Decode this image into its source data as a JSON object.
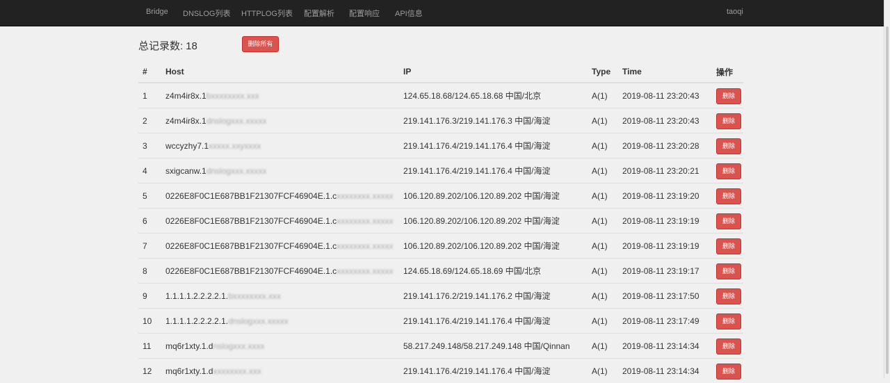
{
  "nav": {
    "items": [
      "Bridge",
      "DNSLOG列表",
      "HTTPLOG列表",
      "配置解析",
      "配置响应",
      "API信息"
    ],
    "user": "taoqi"
  },
  "summary": {
    "label": "总记录数:",
    "count": "18",
    "delete_all": "删除所有"
  },
  "table": {
    "headers": [
      "#",
      "Host",
      "IP",
      "Type",
      "Time",
      "操作"
    ],
    "rows": [
      {
        "num": "1",
        "host": "z4m4ir8x.1",
        "host_hidden": "bxxxxxxxx.xxx",
        "ip": "124.65.18.68/124.65.18.68 中国/北京",
        "type": "A(1)",
        "time": "2019-08-11 23:20:43",
        "action": "删除"
      },
      {
        "num": "2",
        "host": "z4m4ir8x.1",
        "host_hidden": "dnslogxxx.xxxxx",
        "ip": "219.141.176.3/219.141.176.3 中国/海淀",
        "type": "A(1)",
        "time": "2019-08-11 23:20:43",
        "action": "删除"
      },
      {
        "num": "3",
        "host": "wccyzhy7.1",
        "host_hidden": "xxxxx.xxyxxxx",
        "ip": "219.141.176.4/219.141.176.4 中国/海淀",
        "type": "A(1)",
        "time": "2019-08-11 23:20:28",
        "action": "删除"
      },
      {
        "num": "4",
        "host": "sxigcanw.1",
        "host_hidden": "dnslogxxx.xxxxx",
        "ip": "219.141.176.4/219.141.176.4 中国/海淀",
        "type": "A(1)",
        "time": "2019-08-11 23:20:21",
        "action": "删除"
      },
      {
        "num": "5",
        "host": "0226E8F0C1E687BB1F21307FCF46904E.1.c",
        "host_hidden": "xxxxxxxx.xxxxx",
        "ip": "106.120.89.202/106.120.89.202 中国/海淀",
        "type": "A(1)",
        "time": "2019-08-11 23:19:20",
        "action": "删除"
      },
      {
        "num": "6",
        "host": "0226E8F0C1E687BB1F21307FCF46904E.1.c",
        "host_hidden": "xxxxxxxx.xxxxx",
        "ip": "106.120.89.202/106.120.89.202 中国/海淀",
        "type": "A(1)",
        "time": "2019-08-11 23:19:19",
        "action": "删除"
      },
      {
        "num": "7",
        "host": "0226E8F0C1E687BB1F21307FCF46904E.1.c",
        "host_hidden": "xxxxxxxx.xxxxx",
        "ip": "106.120.89.202/106.120.89.202 中国/海淀",
        "type": "A(1)",
        "time": "2019-08-11 23:19:19",
        "action": "删除"
      },
      {
        "num": "8",
        "host": "0226E8F0C1E687BB1F21307FCF46904E.1.c",
        "host_hidden": "xxxxxxxx.xxxxx",
        "ip": "124.65.18.69/124.65.18.69 中国/北京",
        "type": "A(1)",
        "time": "2019-08-11 23:19:17",
        "action": "删除"
      },
      {
        "num": "9",
        "host": "1.1.1.1.2.2.2.2.1.",
        "host_hidden": "bxxxxxxxx.xxx",
        "ip": "219.141.176.2/219.141.176.2 中国/海淀",
        "type": "A(1)",
        "time": "2019-08-11 23:17:50",
        "action": "删除"
      },
      {
        "num": "10",
        "host": "1.1.1.1.2.2.2.2.1.",
        "host_hidden": "dnslogxxx.xxxxx",
        "ip": "219.141.176.4/219.141.176.4 中国/海淀",
        "type": "A(1)",
        "time": "2019-08-11 23:17:49",
        "action": "删除"
      },
      {
        "num": "11",
        "host": "mq6r1xty.1.d",
        "host_hidden": "nslogxxx.xxxx",
        "ip": "58.217.249.148/58.217.249.148 中国/Qinnan",
        "type": "A(1)",
        "time": "2019-08-11 23:14:34",
        "action": "删除"
      },
      {
        "num": "12",
        "host": "mq6r1xty.1.d",
        "host_hidden": "xxxxxxxx.xxx",
        "ip": "219.141.176.4/219.141.176.4 中国/海淀",
        "type": "A(1)",
        "time": "2019-08-11 23:14:34",
        "action": "删除"
      }
    ]
  },
  "colors": {
    "navbar_bg": "#222222",
    "nav_text": "#9d9d9d",
    "page_bg": "#f0f0f0",
    "danger": "#d9534f"
  }
}
